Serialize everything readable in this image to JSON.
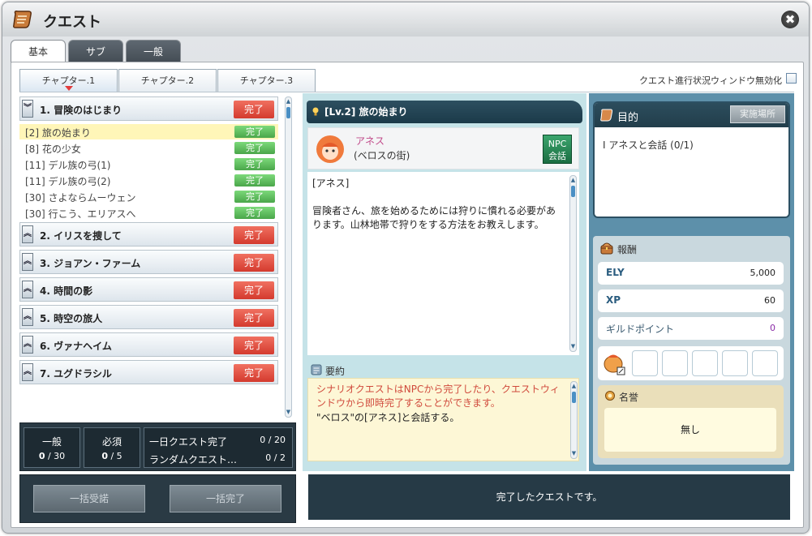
{
  "window": {
    "title": "クエスト",
    "close_glyph": "✖"
  },
  "main_tabs": [
    {
      "label": "基本"
    },
    {
      "label": "サブ"
    },
    {
      "label": "一般"
    }
  ],
  "chapter_tabs": [
    {
      "label": "チャプター.1"
    },
    {
      "label": "チャプター.2"
    },
    {
      "label": "チャプター.3"
    }
  ],
  "disable_window_label": "クエスト進行状況ウィンドウ無効化",
  "chapters": [
    {
      "title": "1. 冒険のはじまり",
      "status": "完了",
      "expanded": true,
      "quests": [
        {
          "label": "[2] 旅の始まり",
          "status": "完了",
          "selected": true
        },
        {
          "label": "[8] 花の少女",
          "status": "完了"
        },
        {
          "label": "[11] デル族の弓(1)",
          "status": "完了"
        },
        {
          "label": "[11] デル族の弓(2)",
          "status": "完了"
        },
        {
          "label": "[30] さよならムーウェン",
          "status": "完了"
        },
        {
          "label": "[30] 行こう、エリアスへ",
          "status": "完了"
        }
      ]
    },
    {
      "title": "2. イリスを捜して",
      "status": "完了"
    },
    {
      "title": "3. ジョアン・ファーム",
      "status": "完了"
    },
    {
      "title": "4. 時間の影",
      "status": "完了"
    },
    {
      "title": "5. 時空の旅人",
      "status": "完了"
    },
    {
      "title": "6. ヴァナヘイム",
      "status": "完了"
    },
    {
      "title": "7. ユグドラシル",
      "status": "完了"
    }
  ],
  "counters": {
    "general": {
      "label": "一般",
      "current": "0",
      "max": "/ 30"
    },
    "required": {
      "label": "必須",
      "current": "0",
      "max": "/ 5"
    },
    "daily": {
      "label": "一日クエスト完了",
      "value": "0 / 20"
    },
    "random": {
      "label": "ランダムクエスト…",
      "value": "0 / 2"
    }
  },
  "bulk_buttons": {
    "accept": "一括受諾",
    "complete": "一括完了"
  },
  "quest_detail": {
    "title": "[Lv.2] 旅の始まり",
    "npc_name": "アネス",
    "npc_location": "(ベロスの街)",
    "npc_talk_line1": "NPC",
    "npc_talk_line2": "会話",
    "dialog_speaker": "[アネス]",
    "dialog_body": "冒険者さん、旅を始めるためには狩りに慣れる必要があります。山林地帯で狩りをする方法をお教えします。",
    "summary_label": "要約",
    "summary_note": "シナリオクエストはNPCから完了したり、クエストウィンドウから即時完了することができます。",
    "summary_text": "\"ベロス\"の[アネス]と会話する。",
    "complete_banner": "完了したクエストです。"
  },
  "objective": {
    "title": "目的",
    "place_button": "実施場所",
    "line": "Ⅰ  アネスと会話 (0/1)"
  },
  "rewards": {
    "title": "報酬",
    "ely": {
      "label": "ELY",
      "value": "5,000"
    },
    "xp": {
      "label": "XP",
      "value": "60"
    },
    "guild": {
      "label": "ギルドポイント",
      "value": "0"
    },
    "fame_title": "名誉",
    "fame_value": "無し"
  },
  "colors": {
    "complete_red": "#d43a2e",
    "complete_green": "#4aa64a",
    "selected_row": "#fff6b8",
    "npc_name": "#c14a8a",
    "guild_points": "#8b2ca7"
  },
  "icons": {
    "title": "scroll-icon",
    "objective": "scroll-icon",
    "reward": "chest-icon",
    "fame": "medal-icon",
    "summary": "note-icon",
    "quest_title": "bulb-icon"
  }
}
